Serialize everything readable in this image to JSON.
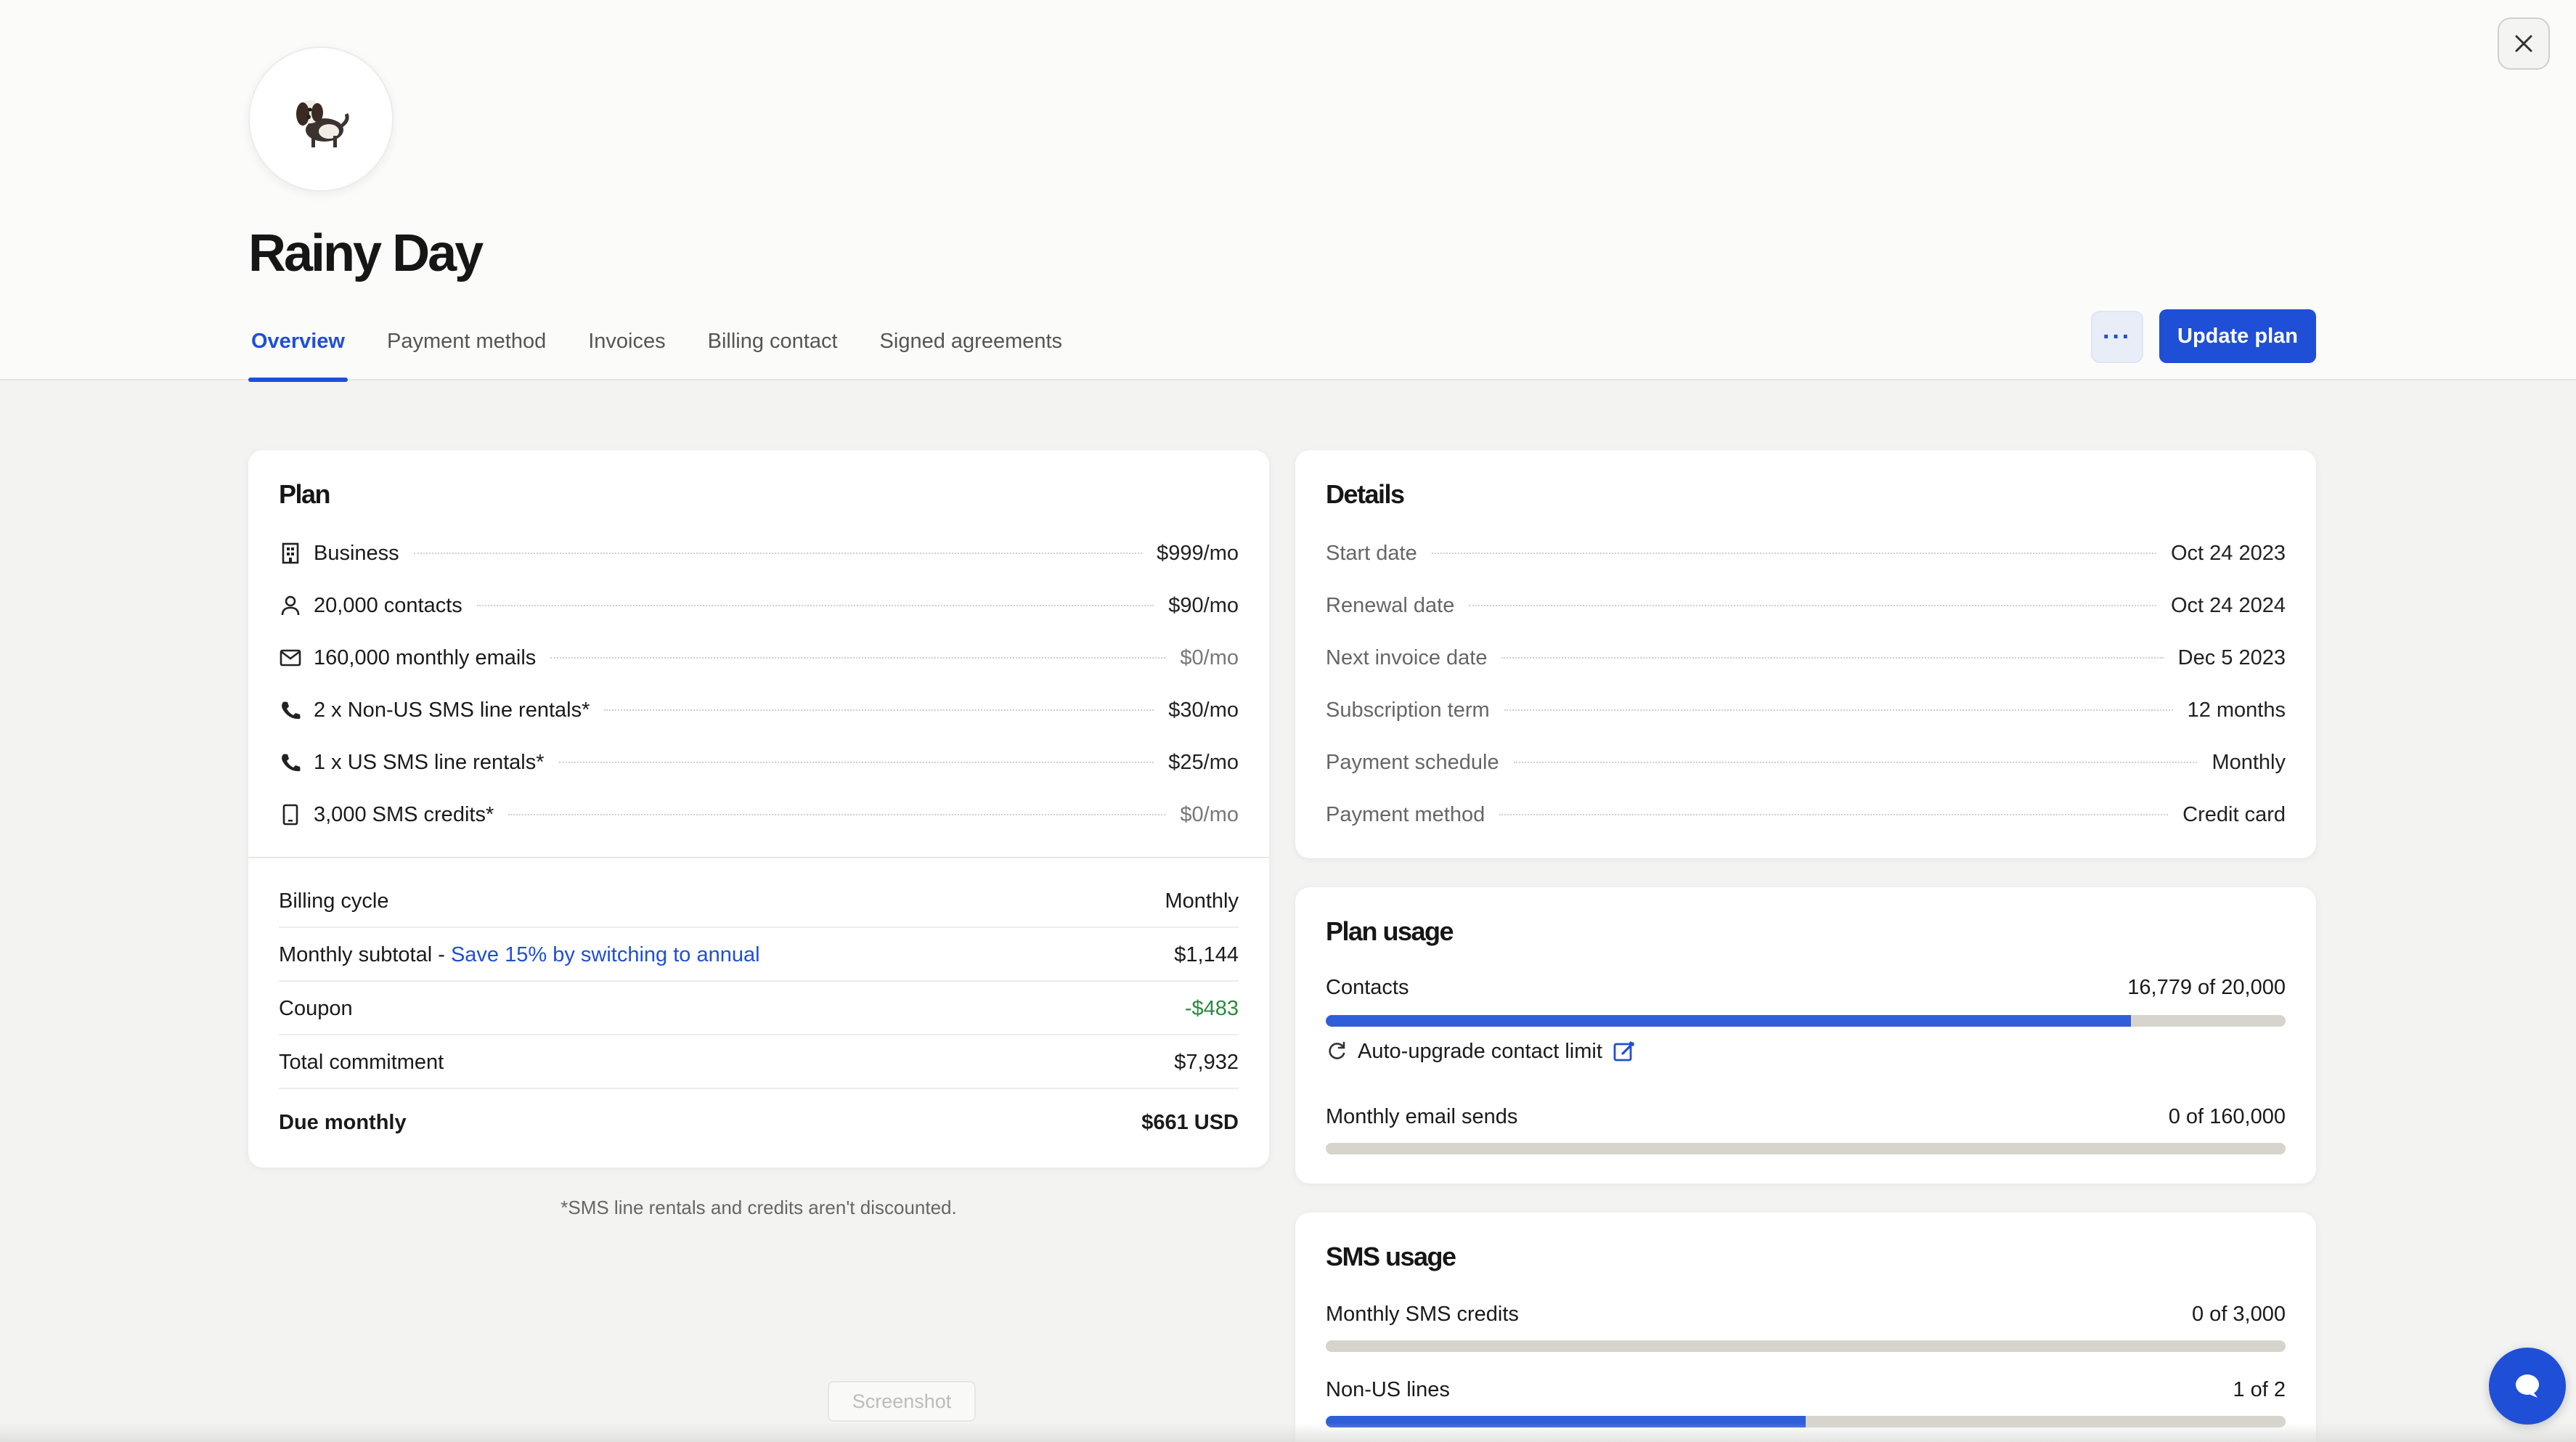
{
  "account": {
    "name": "Rainy Day"
  },
  "tabs": [
    {
      "label": "Overview"
    },
    {
      "label": "Payment method"
    },
    {
      "label": "Invoices"
    },
    {
      "label": "Billing contact"
    },
    {
      "label": "Signed agreements"
    }
  ],
  "header_actions": {
    "more_label": "···",
    "update_label": "Update plan"
  },
  "plan": {
    "title": "Plan",
    "items": [
      {
        "icon": "building-icon",
        "label": "Business",
        "value": "$999/mo",
        "muted": false
      },
      {
        "icon": "person-icon",
        "label": "20,000 contacts",
        "value": "$90/mo",
        "muted": false
      },
      {
        "icon": "mail-icon",
        "label": "160,000 monthly emails",
        "value": "$0/mo",
        "muted": true
      },
      {
        "icon": "phone-icon",
        "label": "2 x Non-US SMS line rentals*",
        "value": "$30/mo",
        "muted": false
      },
      {
        "icon": "phone-icon",
        "label": "1 x US SMS line rentals*",
        "value": "$25/mo",
        "muted": false
      },
      {
        "icon": "mobile-icon",
        "label": "3,000 SMS credits*",
        "value": "$0/mo",
        "muted": true
      }
    ],
    "summary": {
      "billing_cycle_label": "Billing cycle",
      "billing_cycle_value": "Monthly",
      "subtotal_label": "Monthly subtotal - ",
      "subtotal_link": "Save 15% by switching to annual",
      "subtotal_value": "$1,144",
      "coupon_label": "Coupon",
      "coupon_value": "-$483",
      "total_label": "Total commitment",
      "total_value": "$7,932",
      "due_label": "Due monthly",
      "due_value": "$661 USD"
    },
    "footnote": "*SMS line rentals and credits aren't discounted."
  },
  "details": {
    "title": "Details",
    "items": [
      {
        "label": "Start date",
        "value": "Oct 24 2023"
      },
      {
        "label": "Renewal date",
        "value": "Oct 24 2024"
      },
      {
        "label": "Next invoice date",
        "value": "Dec 5 2023"
      },
      {
        "label": "Subscription term",
        "value": "12 months"
      },
      {
        "label": "Payment schedule",
        "value": "Monthly"
      },
      {
        "label": "Payment method",
        "value": "Credit card"
      }
    ]
  },
  "plan_usage": {
    "title": "Plan usage",
    "contacts_label": "Contacts",
    "contacts_value": "16,779 of 20,000",
    "contacts_fraction": 0.839,
    "auto_upgrade_label": "Auto-upgrade contact limit",
    "emails_label": "Monthly email sends",
    "emails_value": "0 of 160,000",
    "emails_fraction": 0
  },
  "sms_usage": {
    "title": "SMS usage",
    "credits_label": "Monthly SMS credits",
    "credits_value": "0 of 3,000",
    "credits_fraction": 0,
    "nonus_label": "Non-US lines",
    "nonus_value": "1 of 2",
    "nonus_fraction": 0.5
  },
  "overlay": {
    "ghost_label": "Screenshot"
  },
  "colors": {
    "accent": "#1f4fd6",
    "coupon_green": "#2c8a3c",
    "bar_track": "#d7d4cd"
  }
}
